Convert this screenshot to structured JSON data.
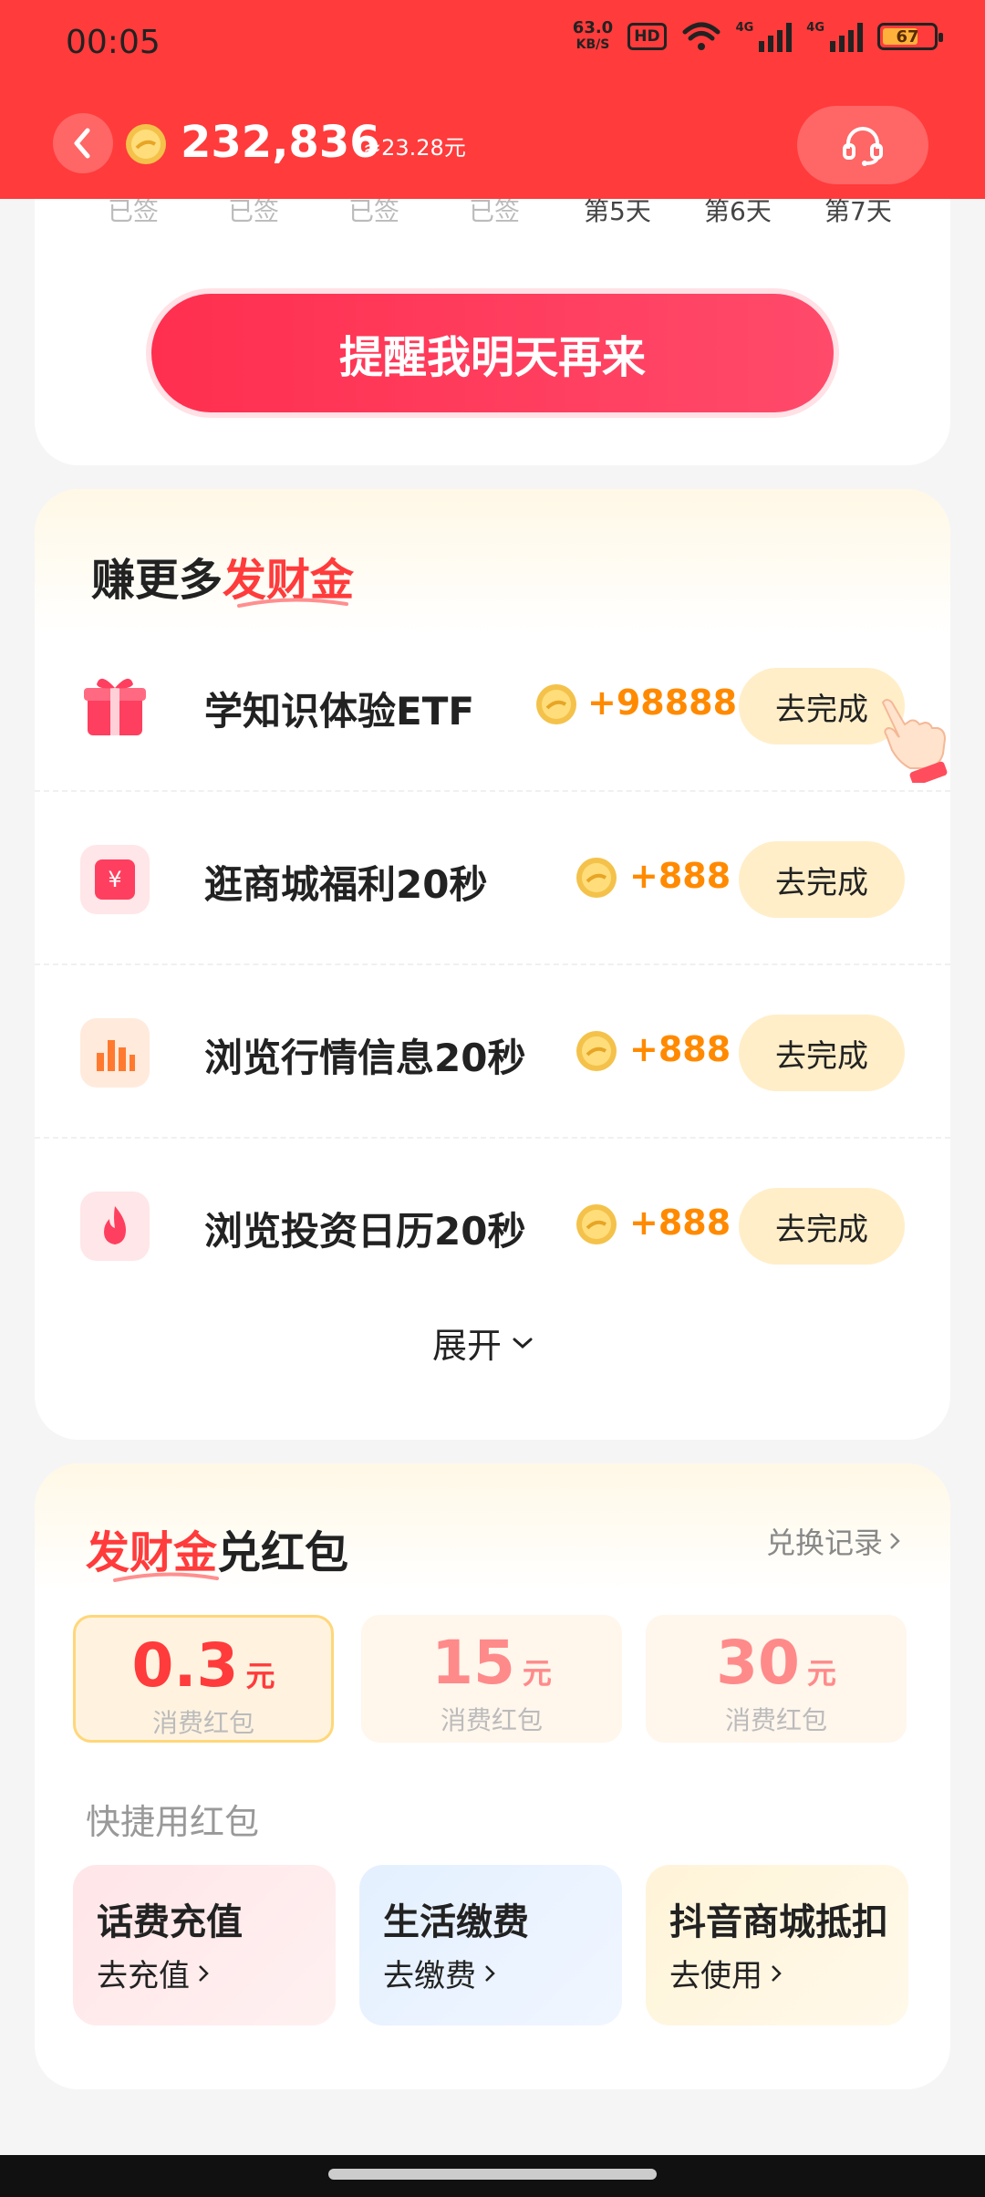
{
  "status_bar": {
    "time": "00:05",
    "net_speed_value": "63.0",
    "net_speed_unit": "KB/S",
    "hd_label": "HD",
    "signal_tag": "4G",
    "battery_level": "67"
  },
  "header": {
    "balance": "232,836",
    "approx": "≈23.28元",
    "back_icon": "chevron-left-icon",
    "support_icon": "headset-icon"
  },
  "checkin": {
    "days": [
      "已签",
      "已签",
      "已签",
      "已签",
      "第5天",
      "第6天",
      "第7天"
    ],
    "remind_button": "提醒我明天再来"
  },
  "earn": {
    "title_prefix": "赚更多",
    "title_highlight": "发财金",
    "tasks": [
      {
        "label": "学知识体验ETF",
        "reward": "+98888",
        "action": "去完成",
        "icon": "gift-icon"
      },
      {
        "label": "逛商城福利20秒",
        "reward": "+888",
        "action": "去完成",
        "icon": "yuan-coupon-icon"
      },
      {
        "label": "浏览行情信息20秒",
        "reward": "+888",
        "action": "去完成",
        "icon": "bar-chart-icon"
      },
      {
        "label": "浏览投资日历20秒",
        "reward": "+888",
        "action": "去完成",
        "icon": "fire-icon"
      }
    ],
    "expand_label": "展开"
  },
  "redeem": {
    "title_highlight": "发财金",
    "title_suffix": "兑红包",
    "record_link": "兑换记录",
    "packets": [
      {
        "amount": "0.3",
        "unit": "元",
        "desc": "消费红包"
      },
      {
        "amount": "15",
        "unit": "元",
        "desc": "消费红包"
      },
      {
        "amount": "30",
        "unit": "元",
        "desc": "消费红包"
      }
    ],
    "quick_label": "快捷用红包",
    "quick": [
      {
        "title": "话费充值",
        "action": "去充值"
      },
      {
        "title": "生活缴费",
        "action": "去缴费"
      },
      {
        "title": "抖音商城抵扣",
        "action": "去使用"
      }
    ]
  },
  "colors": {
    "brand_red": "#ff3b3b",
    "reward_orange": "#ff8a00",
    "button_cream": "#ffeec8"
  }
}
